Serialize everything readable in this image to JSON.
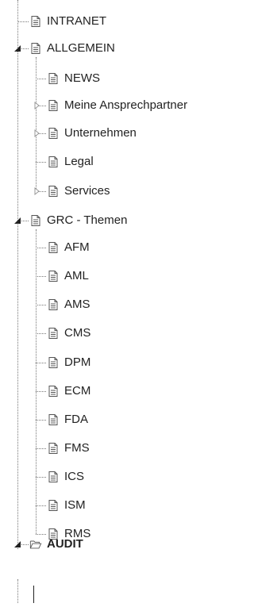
{
  "tree": {
    "intranet": {
      "label": "INTRANET"
    },
    "allgemein": {
      "label": "ALLGEMEIN",
      "children": [
        "NEWS",
        "Meine Ansprechpartner",
        "Unternehmen",
        "Legal",
        "Services"
      ]
    },
    "grc": {
      "label": "GRC - Themen",
      "children": [
        "AFM",
        "AML",
        "AMS",
        "CMS",
        "DPM",
        "ECM",
        "FDA",
        "FMS",
        "ICS",
        "ISM",
        "RMS"
      ]
    },
    "audit": {
      "label": "AUDIT"
    }
  },
  "icons": {
    "document": "document-icon",
    "folder": "folder-open-icon",
    "expanded": "triangle-down-icon",
    "collapsed": "triangle-right-icon"
  }
}
